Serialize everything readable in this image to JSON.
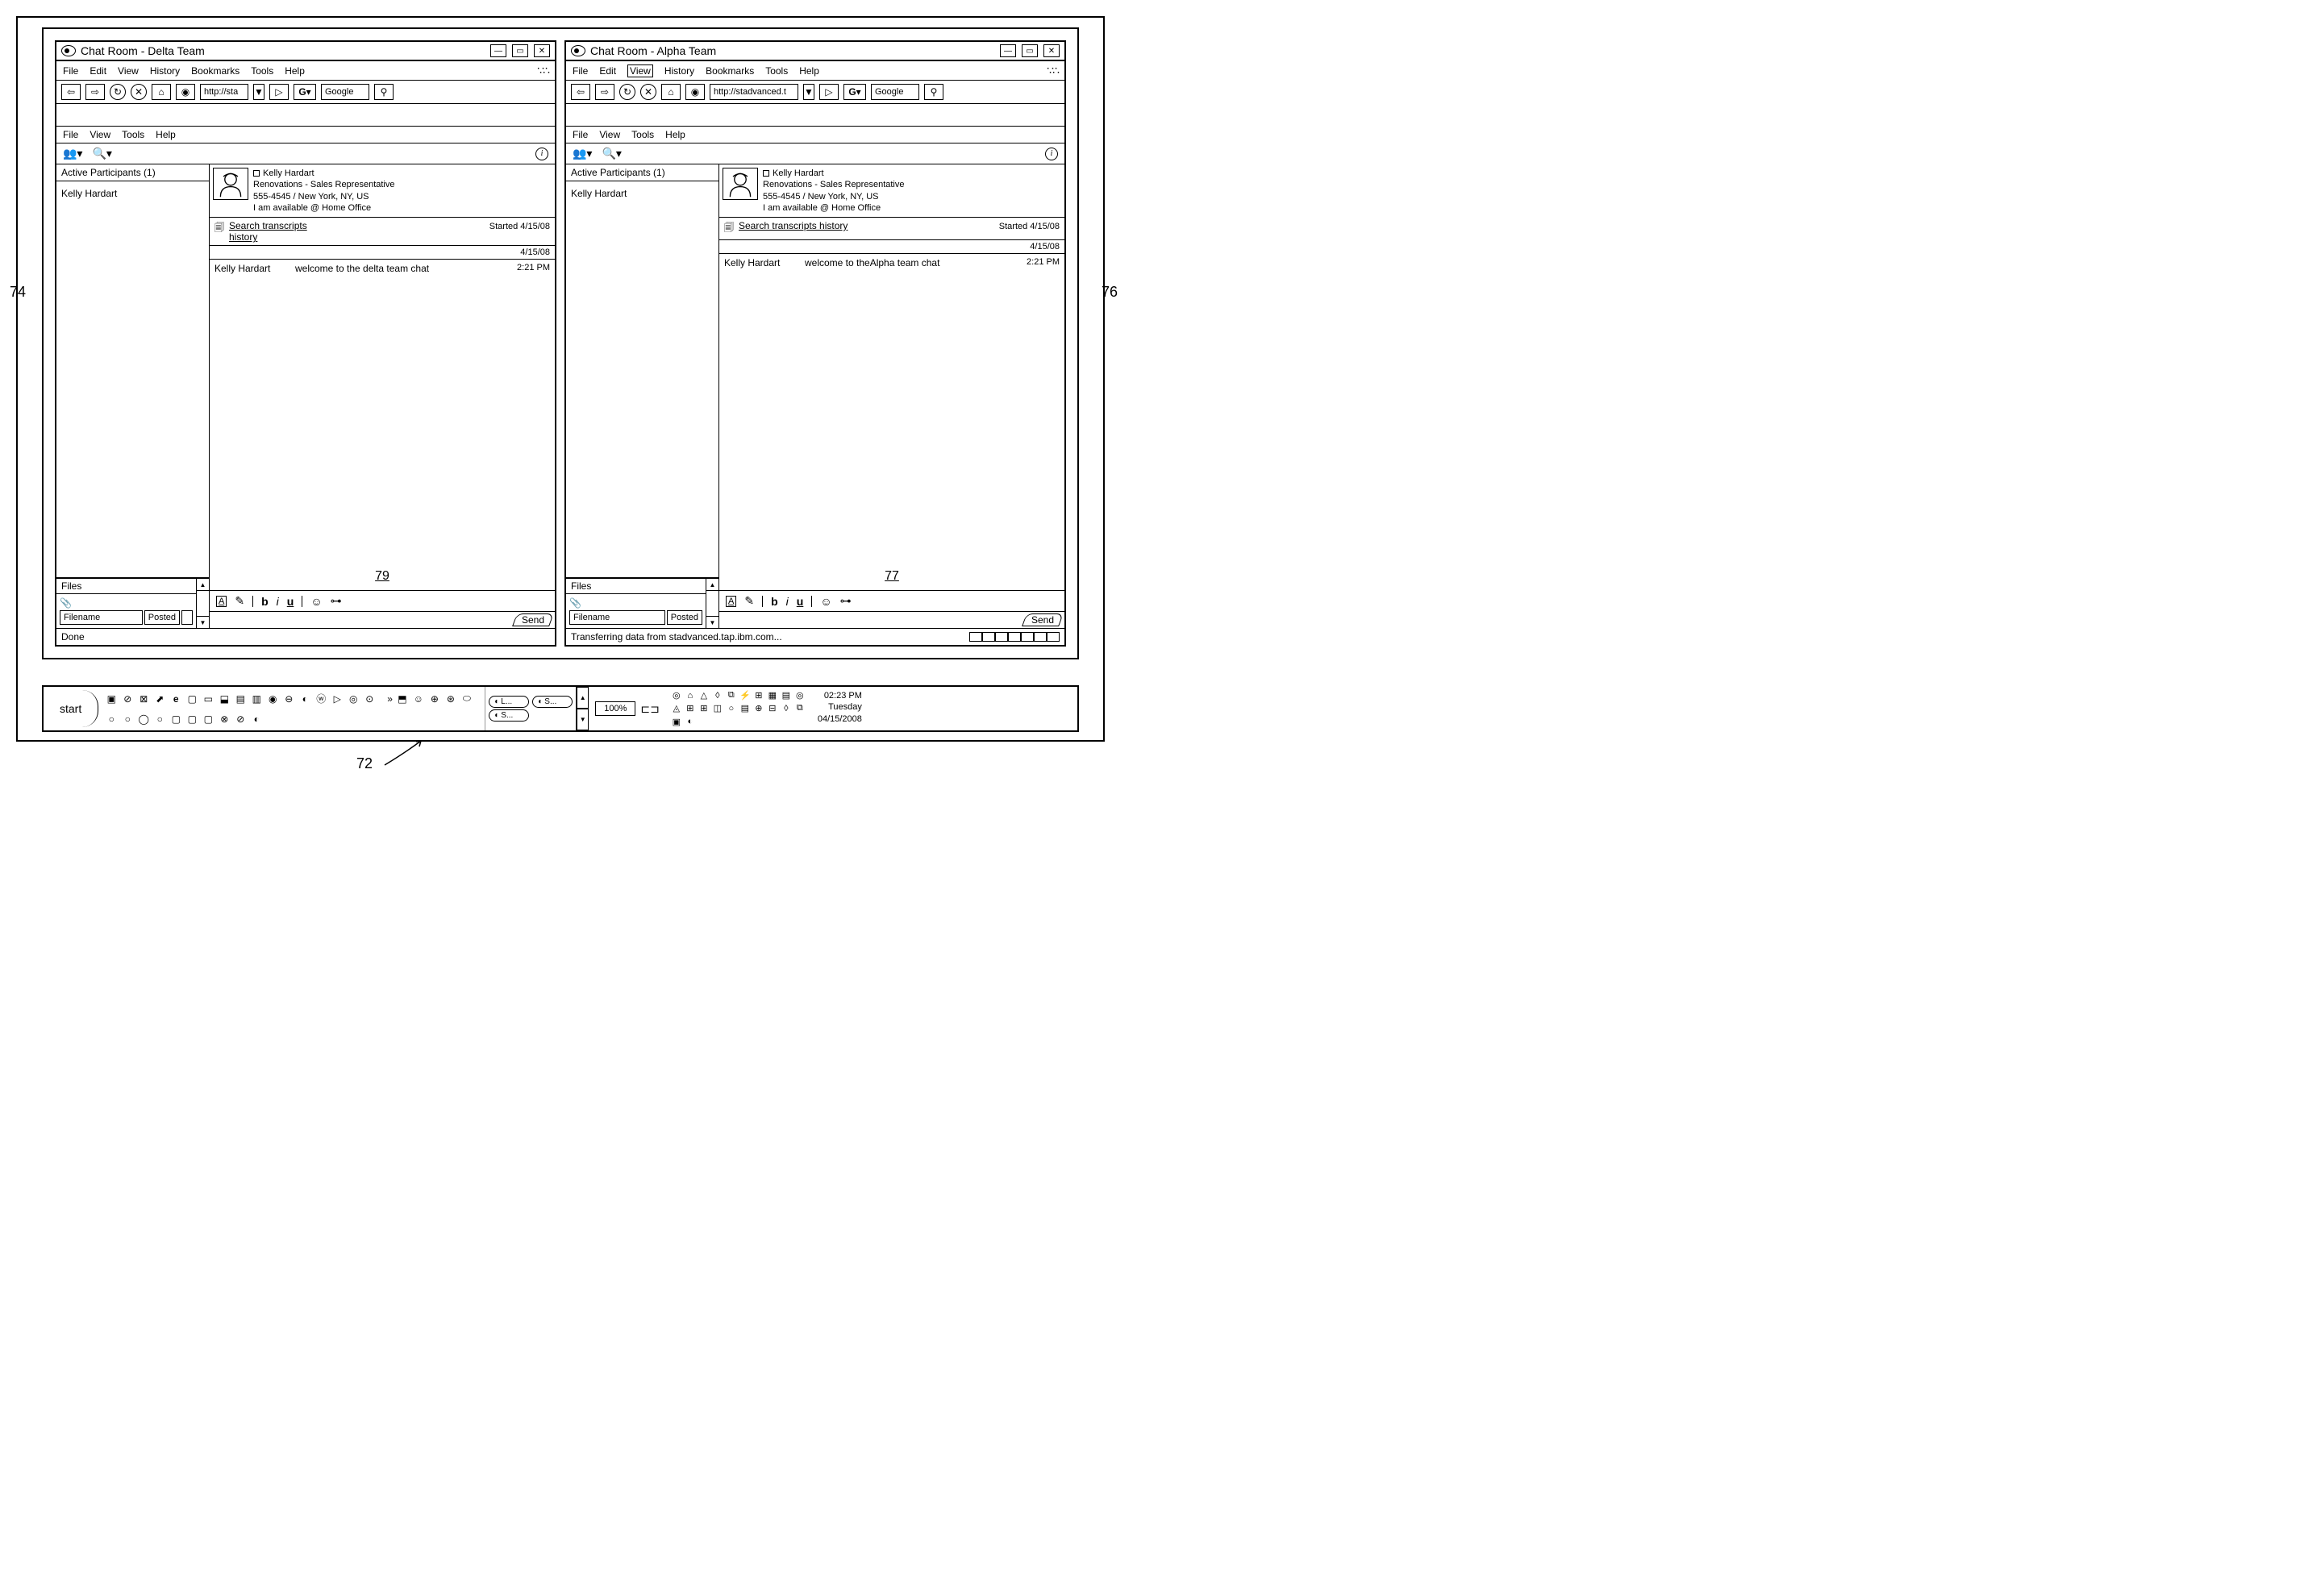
{
  "windows": [
    {
      "title": "Chat Room - Delta Team",
      "browser_menu": [
        "File",
        "Edit",
        "View",
        "History",
        "Bookmarks",
        "Tools",
        "Help"
      ],
      "url": "http://sta",
      "search_engine": "Google",
      "app_menu": [
        "File",
        "View",
        "Tools",
        "Help"
      ],
      "participants_header": "Active Participants (1)",
      "participants": [
        "Kelly Hardart"
      ],
      "files_label": "Files",
      "files_cols": [
        "Filename",
        "Posted"
      ],
      "profile": {
        "name": "Kelly Hardart",
        "role": "Renovations - Sales Representative",
        "phone": "555-4545 / New York, NY, US",
        "status": "I am available @ Home Office"
      },
      "search_link": "Search transcripts history",
      "started": "Started 4/15/08",
      "chat_date": "4/15/08",
      "message": {
        "sender": "Kelly Hardart",
        "text": "welcome to the delta team chat",
        "time": "2:21 PM"
      },
      "ref": "79",
      "send": "Send",
      "status_text": "Done"
    },
    {
      "title": "Chat Room - Alpha Team",
      "browser_menu": [
        "File",
        "Edit",
        "View",
        "History",
        "Bookmarks",
        "Tools",
        "Help"
      ],
      "url": "http://stadvanced.t",
      "search_engine": "Google",
      "app_menu": [
        "File",
        "View",
        "Tools",
        "Help"
      ],
      "participants_header": "Active Participants (1)",
      "participants": [
        "Kelly Hardart"
      ],
      "files_label": "Files",
      "files_cols": [
        "Filename",
        "Posted"
      ],
      "profile": {
        "name": "Kelly Hardart",
        "role": "Renovations - Sales Representative",
        "phone": "555-4545 / New York, NY, US",
        "status": "I am available @ Home Office"
      },
      "search_link": "Search transcripts history",
      "started": "Started 4/15/08",
      "chat_date": "4/15/08",
      "message": {
        "sender": "Kelly Hardart",
        "text": "welcome to theAlpha team chat",
        "time": "2:21 PM"
      },
      "ref": "77",
      "send": "Send",
      "status_text": "Transferring data from stadvanced.tap.ibm.com..."
    }
  ],
  "taskbar": {
    "start": "start",
    "more": "»",
    "task_windows": [
      "L...",
      "S...",
      "S..."
    ],
    "battery": "100%",
    "clock": {
      "time": "02:23 PM",
      "day": "Tuesday",
      "date": "04/15/2008"
    }
  },
  "refs": {
    "left": "74",
    "right": "76",
    "bottom": "72"
  }
}
